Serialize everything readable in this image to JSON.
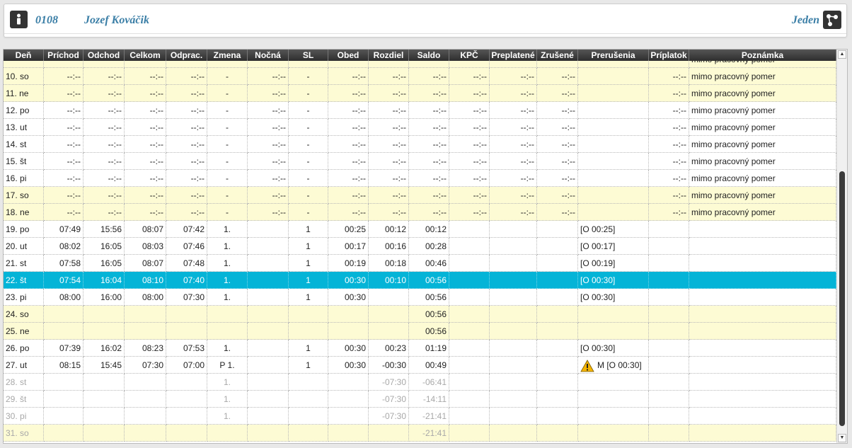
{
  "header": {
    "employee_id": "0108",
    "employee_name": "Jozef Kováčik",
    "view_label": "Jeden",
    "person_icon": "person-icon",
    "org_icon": "org-chart-icon"
  },
  "table": {
    "columns": [
      "Deň",
      "Príchod",
      "Odchod",
      "Celkom",
      "Odprac.",
      "Zmena",
      "Nočná",
      "SL",
      "Obed",
      "Rozdiel",
      "Saldo",
      "KPČ",
      "Preplatené",
      "Zrušené",
      "Prerušenia",
      "Príplatok",
      "Poznámka"
    ],
    "partial_top_note": "mimo pracovný pomer",
    "rows": [
      {
        "style": "yellow",
        "cells": [
          "10. so",
          "--:--",
          "--:--",
          "--:--",
          "--:--",
          "-",
          "--:--",
          "-",
          "--:--",
          "--:--",
          "--:--",
          "--:--",
          "--:--",
          "--:--",
          "",
          "--:--",
          "mimo pracovný pomer"
        ]
      },
      {
        "style": "yellow",
        "cells": [
          "11. ne",
          "--:--",
          "--:--",
          "--:--",
          "--:--",
          "-",
          "--:--",
          "-",
          "--:--",
          "--:--",
          "--:--",
          "--:--",
          "--:--",
          "--:--",
          "",
          "--:--",
          "mimo pracovný pomer"
        ]
      },
      {
        "style": "white",
        "cells": [
          "12. po",
          "--:--",
          "--:--",
          "--:--",
          "--:--",
          "-",
          "--:--",
          "-",
          "--:--",
          "--:--",
          "--:--",
          "--:--",
          "--:--",
          "--:--",
          "",
          "--:--",
          "mimo pracovný pomer"
        ]
      },
      {
        "style": "white",
        "cells": [
          "13. ut",
          "--:--",
          "--:--",
          "--:--",
          "--:--",
          "-",
          "--:--",
          "-",
          "--:--",
          "--:--",
          "--:--",
          "--:--",
          "--:--",
          "--:--",
          "",
          "--:--",
          "mimo pracovný pomer"
        ]
      },
      {
        "style": "white",
        "cells": [
          "14. st",
          "--:--",
          "--:--",
          "--:--",
          "--:--",
          "-",
          "--:--",
          "-",
          "--:--",
          "--:--",
          "--:--",
          "--:--",
          "--:--",
          "--:--",
          "",
          "--:--",
          "mimo pracovný pomer"
        ]
      },
      {
        "style": "white",
        "cells": [
          "15. št",
          "--:--",
          "--:--",
          "--:--",
          "--:--",
          "-",
          "--:--",
          "-",
          "--:--",
          "--:--",
          "--:--",
          "--:--",
          "--:--",
          "--:--",
          "",
          "--:--",
          "mimo pracovný pomer"
        ]
      },
      {
        "style": "white",
        "cells": [
          "16. pi",
          "--:--",
          "--:--",
          "--:--",
          "--:--",
          "-",
          "--:--",
          "-",
          "--:--",
          "--:--",
          "--:--",
          "--:--",
          "--:--",
          "--:--",
          "",
          "--:--",
          "mimo pracovný pomer"
        ]
      },
      {
        "style": "yellow",
        "cells": [
          "17. so",
          "--:--",
          "--:--",
          "--:--",
          "--:--",
          "-",
          "--:--",
          "-",
          "--:--",
          "--:--",
          "--:--",
          "--:--",
          "--:--",
          "--:--",
          "",
          "--:--",
          "mimo pracovný pomer"
        ]
      },
      {
        "style": "yellow",
        "cells": [
          "18. ne",
          "--:--",
          "--:--",
          "--:--",
          "--:--",
          "-",
          "--:--",
          "-",
          "--:--",
          "--:--",
          "--:--",
          "--:--",
          "--:--",
          "--:--",
          "",
          "--:--",
          "mimo pracovný pomer"
        ]
      },
      {
        "style": "white",
        "cells": [
          "19. po",
          "07:49",
          "15:56",
          "08:07",
          "07:42",
          "1.",
          "",
          "1",
          "00:25",
          "00:12",
          "00:12",
          "",
          "",
          "",
          "[O 00:25]",
          "",
          ""
        ]
      },
      {
        "style": "white",
        "cells": [
          "20. ut",
          "08:02",
          "16:05",
          "08:03",
          "07:46",
          "1.",
          "",
          "1",
          "00:17",
          "00:16",
          "00:28",
          "",
          "",
          "",
          "[O 00:17]",
          "",
          ""
        ]
      },
      {
        "style": "white",
        "cells": [
          "21. st",
          "07:58",
          "16:05",
          "08:07",
          "07:48",
          "1.",
          "",
          "1",
          "00:19",
          "00:18",
          "00:46",
          "",
          "",
          "",
          "[O 00:19]",
          "",
          ""
        ]
      },
      {
        "style": "selected",
        "cells": [
          "22. št",
          "07:54",
          "16:04",
          "08:10",
          "07:40",
          "1.",
          "",
          "1",
          "00:30",
          "00:10",
          "00:56",
          "",
          "",
          "",
          "[O 00:30]",
          "",
          ""
        ]
      },
      {
        "style": "white",
        "cells": [
          "23. pi",
          "08:00",
          "16:00",
          "08:00",
          "07:30",
          "1.",
          "",
          "1",
          "00:30",
          "",
          "00:56",
          "",
          "",
          "",
          "[O 00:30]",
          "",
          ""
        ]
      },
      {
        "style": "yellow",
        "cells": [
          "24. so",
          "",
          "",
          "",
          "",
          "",
          "",
          "",
          "",
          "",
          "00:56",
          "",
          "",
          "",
          "",
          "",
          ""
        ]
      },
      {
        "style": "yellow",
        "cells": [
          "25. ne",
          "",
          "",
          "",
          "",
          "",
          "",
          "",
          "",
          "",
          "00:56",
          "",
          "",
          "",
          "",
          "",
          ""
        ]
      },
      {
        "style": "white",
        "cells": [
          "26. po",
          "07:39",
          "16:02",
          "08:23",
          "07:53",
          "1.",
          "",
          "1",
          "00:30",
          "00:23",
          "01:19",
          "",
          "",
          "",
          "[O 00:30]",
          "",
          ""
        ]
      },
      {
        "style": "white",
        "warning": true,
        "cells": [
          "27. ut",
          "08:15",
          "15:45",
          "07:30",
          "07:00",
          "P 1.",
          "",
          "1",
          "00:30",
          "-00:30",
          "00:49",
          "",
          "",
          "",
          "M [O 00:30]",
          "",
          ""
        ]
      },
      {
        "style": "white muted",
        "cells": [
          "28. st",
          "",
          "",
          "",
          "",
          "1.",
          "",
          "",
          "",
          "-07:30",
          "-06:41",
          "",
          "",
          "",
          "",
          "",
          ""
        ]
      },
      {
        "style": "white muted",
        "cells": [
          "29. št",
          "",
          "",
          "",
          "",
          "1.",
          "",
          "",
          "",
          "-07:30",
          "-14:11",
          "",
          "",
          "",
          "",
          "",
          ""
        ]
      },
      {
        "style": "white muted",
        "cells": [
          "30. pi",
          "",
          "",
          "",
          "",
          "1.",
          "",
          "",
          "",
          "-07:30",
          "-21:41",
          "",
          "",
          "",
          "",
          "",
          ""
        ]
      },
      {
        "style": "yellow muted",
        "cells": [
          "31. so",
          "",
          "",
          "",
          "",
          "",
          "",
          "",
          "",
          "",
          "-21:41",
          "",
          "",
          "",
          "",
          "",
          ""
        ]
      }
    ]
  },
  "warning_icon": "warning-icon",
  "scroll_up_icon": "scroll-up-icon",
  "scroll_down_icon": "scroll-down-icon"
}
